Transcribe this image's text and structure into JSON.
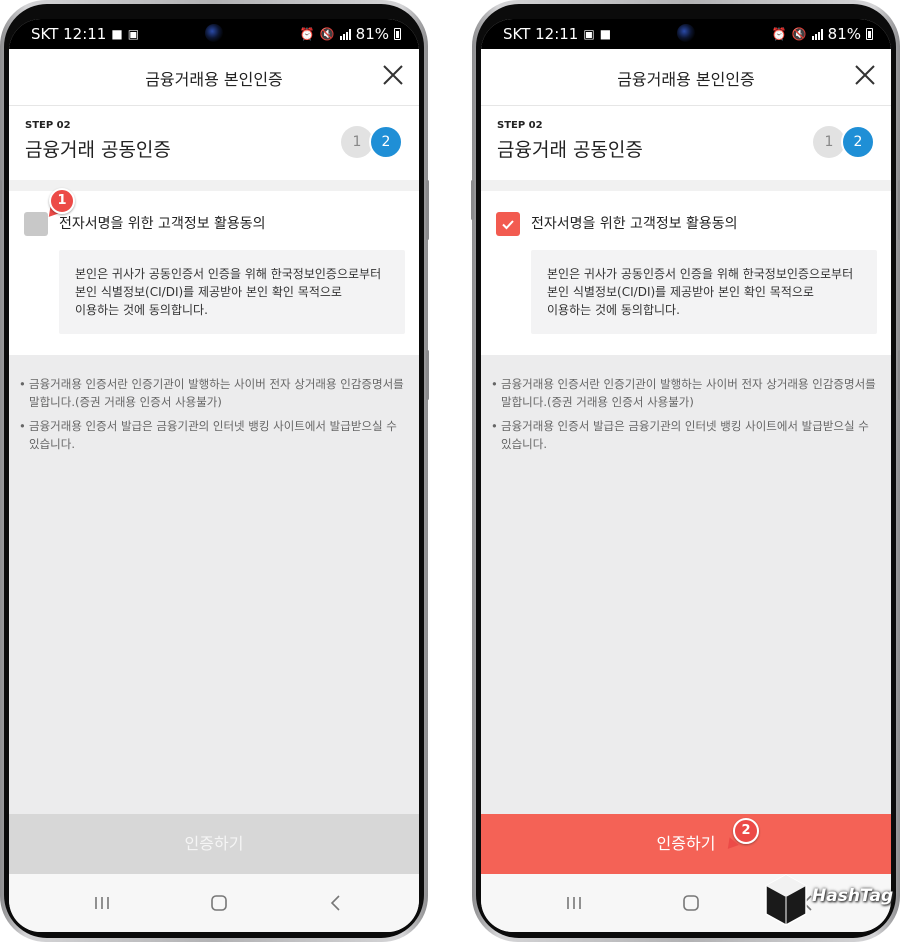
{
  "status_bar": {
    "carrier_time": "SKT 12:11",
    "battery": "81%"
  },
  "header": {
    "title": "금융거래용 본인인증",
    "close_icon": "close-icon"
  },
  "step": {
    "label": "STEP 02",
    "title": "금융거래 공동인증",
    "dots": [
      "1",
      "2"
    ],
    "active_step": 2,
    "active_color": "#1f8fd6"
  },
  "consent": {
    "label": "전자서명을 위한 고객정보 활용동의",
    "text_lines": [
      "본인은 귀사가 공동인증서 인증을 위해 한국정보인증으로부터",
      "본인 식별정보(CI/DI)를 제공받아 본인 확인 목적으로",
      "이용하는 것에 동의합니다."
    ]
  },
  "notes": [
    "금융거래용 인증서란 인증기관이 발행하는 사이버 전자 상거래용 인감증명서를 말합니다.(증권 거래용 인증서 사용불가)",
    "금융거래용 인증서 발급은 금융기관의 인터넷 뱅킹 사이트에서 발급받으실 수 있습니다."
  ],
  "screens": [
    {
      "checkbox_checked": false,
      "button_label": "인증하기",
      "button_state": "disabled",
      "button_color": "#d7d7d7",
      "callout": "1"
    },
    {
      "checkbox_checked": true,
      "button_label": "인증하기",
      "button_state": "active",
      "button_color": "#f46256",
      "callout": "2"
    }
  ],
  "accent_color": "#f25b50",
  "watermark": {
    "text": "HashTag"
  }
}
